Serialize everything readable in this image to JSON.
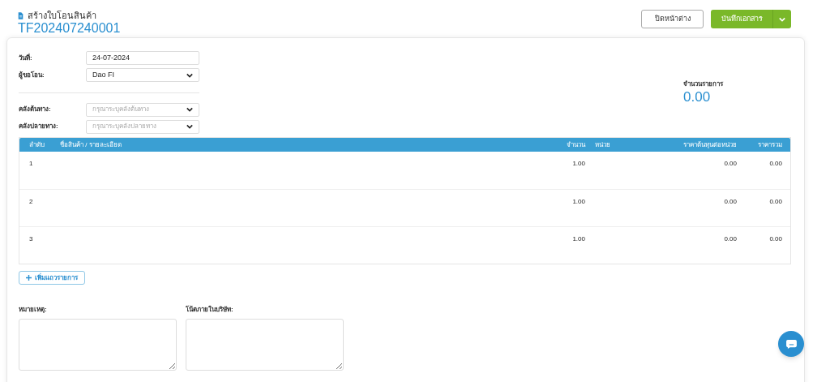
{
  "header": {
    "title": "สร้างใบโอนสินค้า",
    "doc_number": "TF202407240001"
  },
  "buttons": {
    "close": "ปิดหน้าต่าง",
    "save": "บันทึกเอกสาร"
  },
  "form": {
    "fields": [
      {
        "label": "วันที่:",
        "kind": "text",
        "value": "24-07-2024"
      },
      {
        "label": "ผู้ขอโอน:",
        "kind": "select",
        "value": "Dao FI"
      },
      {
        "label": "คลังต้นทาง:",
        "kind": "select",
        "placeholder": "กรุณาระบุคลังต้นทาง"
      },
      {
        "label": "คลังปลายทาง:",
        "kind": "select",
        "placeholder": "กรุณาระบุคลังปลายทาง"
      }
    ]
  },
  "summary": {
    "label": "จำนวนรายการ",
    "value": "0.00"
  },
  "table": {
    "columns": [
      "ลำดับ",
      "ชื่อสินค้า / รายละเอียด",
      "จำนวน",
      "หน่วย",
      "ราคาต้นทุนต่อหน่วย",
      "ราคารวม"
    ],
    "rows": [
      {
        "no": "1",
        "qty": "1.00",
        "unit_cost": "0.00",
        "total": "0.00"
      },
      {
        "no": "2",
        "qty": "1.00",
        "unit_cost": "0.00",
        "total": "0.00"
      },
      {
        "no": "3",
        "qty": "1.00",
        "unit_cost": "0.00",
        "total": "0.00"
      }
    ]
  },
  "add_row_button": "เพิ่มแถวรายการ",
  "notes": [
    {
      "label": "หมายเหตุ:"
    },
    {
      "label": "โน้ตภายในบริษัท:"
    }
  ]
}
